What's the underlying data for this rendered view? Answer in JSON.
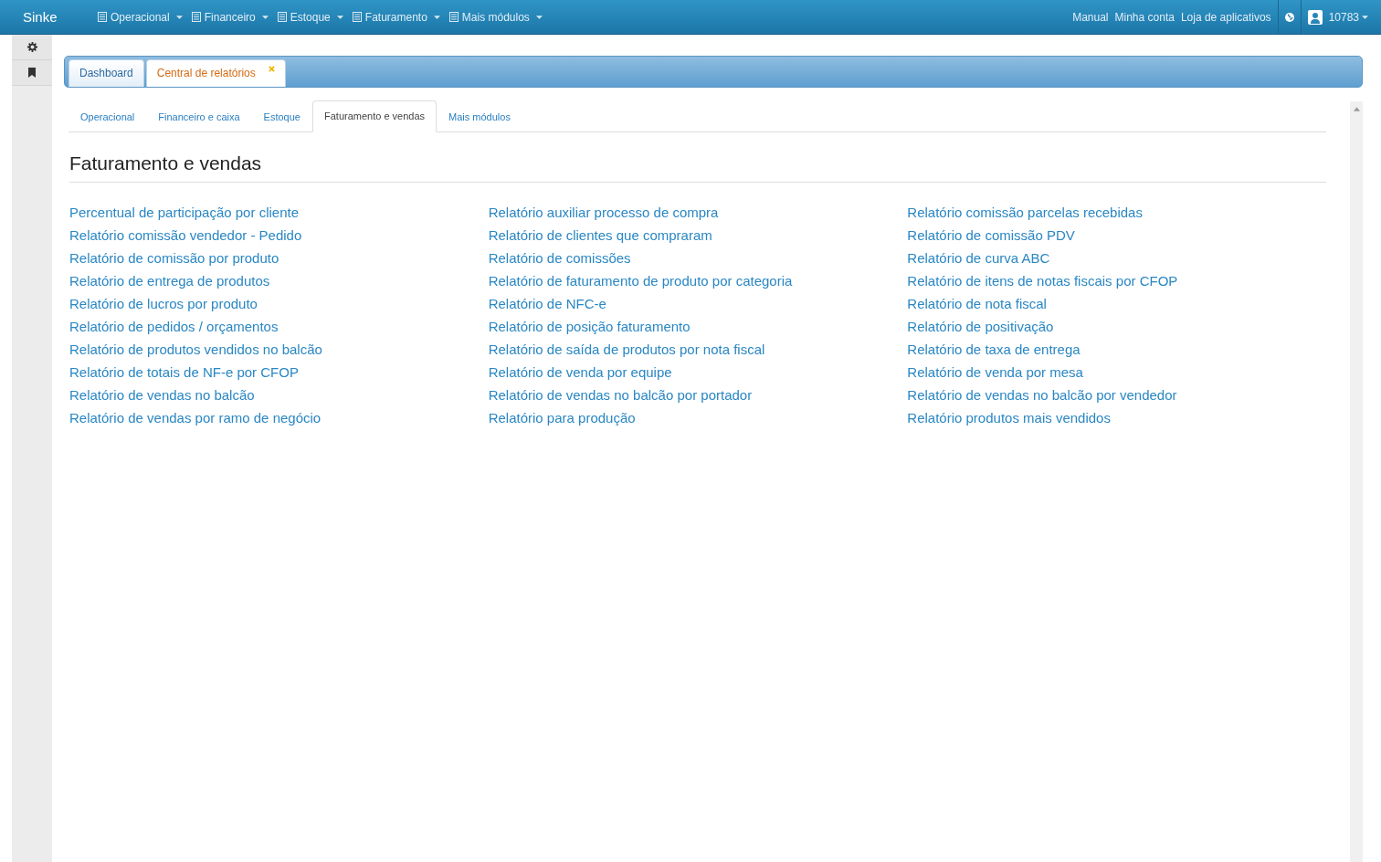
{
  "navbar": {
    "brand": "Sinke",
    "menus": [
      {
        "label": "Operacional"
      },
      {
        "label": "Financeiro"
      },
      {
        "label": "Estoque"
      },
      {
        "label": "Faturamento"
      },
      {
        "label": "Mais módulos"
      }
    ],
    "links": [
      "Manual",
      "Minha conta",
      "Loja de aplicativos"
    ],
    "user": "10783"
  },
  "workspace_tabs": [
    {
      "label": "Dashboard",
      "selected": false,
      "closable": false
    },
    {
      "label": "Central de relatórios",
      "selected": true,
      "closable": true
    }
  ],
  "section_tabs": [
    {
      "label": "Operacional",
      "selected": false
    },
    {
      "label": "Financeiro e caixa",
      "selected": false
    },
    {
      "label": "Estoque",
      "selected": false
    },
    {
      "label": "Faturamento e vendas",
      "selected": true
    },
    {
      "label": "Mais módulos",
      "selected": false
    }
  ],
  "heading": "Faturamento e vendas",
  "report_columns": [
    [
      "Percentual de participação por cliente",
      "Relatório comissão vendedor - Pedido",
      "Relatório de comissão por produto",
      "Relatório de entrega de produtos",
      "Relatório de lucros por produto",
      "Relatório de pedidos / orçamentos",
      "Relatório de produtos vendidos no balcão",
      "Relatório de totais de NF-e por CFOP",
      "Relatório de vendas no balcão",
      "Relatório de vendas por ramo de negócio"
    ],
    [
      "Relatório auxiliar processo de compra",
      "Relatório de clientes que compraram",
      "Relatório de comissões",
      "Relatório de faturamento de produto por categoria",
      "Relatório de NFC-e",
      "Relatório de posição faturamento",
      "Relatório de saída de produtos por nota fiscal",
      "Relatório de venda por equipe",
      "Relatório de vendas no balcão por portador",
      "Relatório para produção"
    ],
    [
      "Relatório comissão parcelas recebidas",
      "Relatório de comissão PDV",
      "Relatório de curva ABC",
      "Relatório de itens de notas fiscais por CFOP",
      "Relatório de nota fiscal",
      "Relatório de positivação",
      "Relatório de taxa de entrega",
      "Relatório de venda por mesa",
      "Relatório de vendas no balcão por vendedor",
      "Relatório produtos mais vendidos"
    ]
  ]
}
